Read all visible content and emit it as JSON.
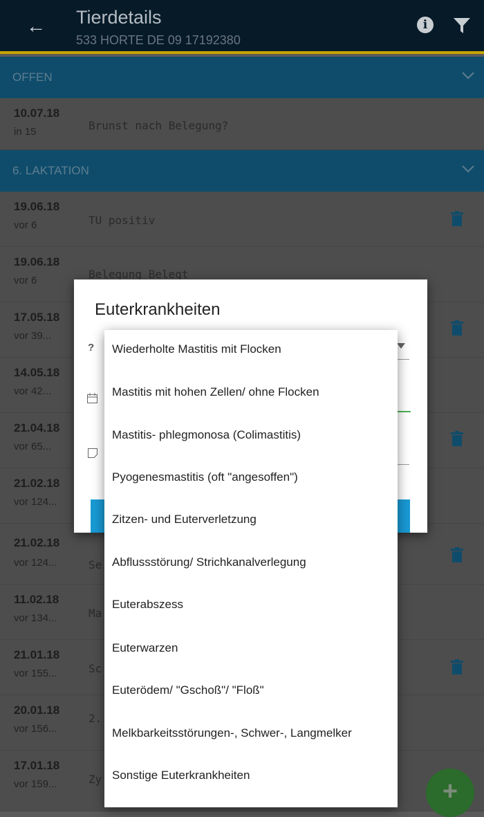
{
  "appbar": {
    "title": "Tierdetails",
    "subtitle": "533 HORTE DE 09 17192380"
  },
  "sections": {
    "open": "OFFEN",
    "lactation": "6. LAKTATION"
  },
  "rows": [
    {
      "date": "10.07.18",
      "rel": "in 15",
      "text": "Brunst nach Belegung?"
    },
    {
      "date": "19.06.18",
      "rel": "vor 6",
      "text": "TU positiv"
    },
    {
      "date": "19.06.18",
      "rel": "vor 6",
      "text": "Belegung Belegt"
    },
    {
      "date": "17.05.18",
      "rel": "vor 39...",
      "text": ""
    },
    {
      "date": "14.05.18",
      "rel": "vor 42...",
      "text": ""
    },
    {
      "date": "21.04.18",
      "rel": "vor 65...",
      "text": ""
    },
    {
      "date": "21.02.18",
      "rel": "vor 124...",
      "text": ""
    },
    {
      "date": "21.02.18",
      "rel": "vor 124...",
      "text": "Se"
    },
    {
      "date": "11.02.18",
      "rel": "vor 134...",
      "text": "Ma"
    },
    {
      "date": "21.01.18",
      "rel": "vor 155...",
      "text": "Sc"
    },
    {
      "date": "20.01.18",
      "rel": "vor 156...",
      "text": "2."
    },
    {
      "date": "17.01.18",
      "rel": "vor 159...",
      "text": "Zy"
    }
  ],
  "dialog": {
    "title": "Euterkrankheiten",
    "question_mark": "?"
  },
  "dropdown": {
    "options": [
      "Wiederholte Mastitis mit Flocken",
      "Mastitis mit hohen Zellen/ ohne Flocken",
      "Mastitis- phlegmonosa (Colimastitis)",
      "Pyogenesmastitis (oft \"angesoffen\")",
      "Zitzen- und Euterverletzung",
      "Abflussstörung/ Strichkanalverlegung",
      "Euterabszess",
      "Euterwarzen",
      "Euterödem/ \"Gschoß\"/ \"Floß\"",
      "Melkbarkeitsstörungen-, Schwer-, Langmelker",
      "Sonstige Euterkrankheiten"
    ]
  },
  "fab": {
    "symbol": "+"
  }
}
